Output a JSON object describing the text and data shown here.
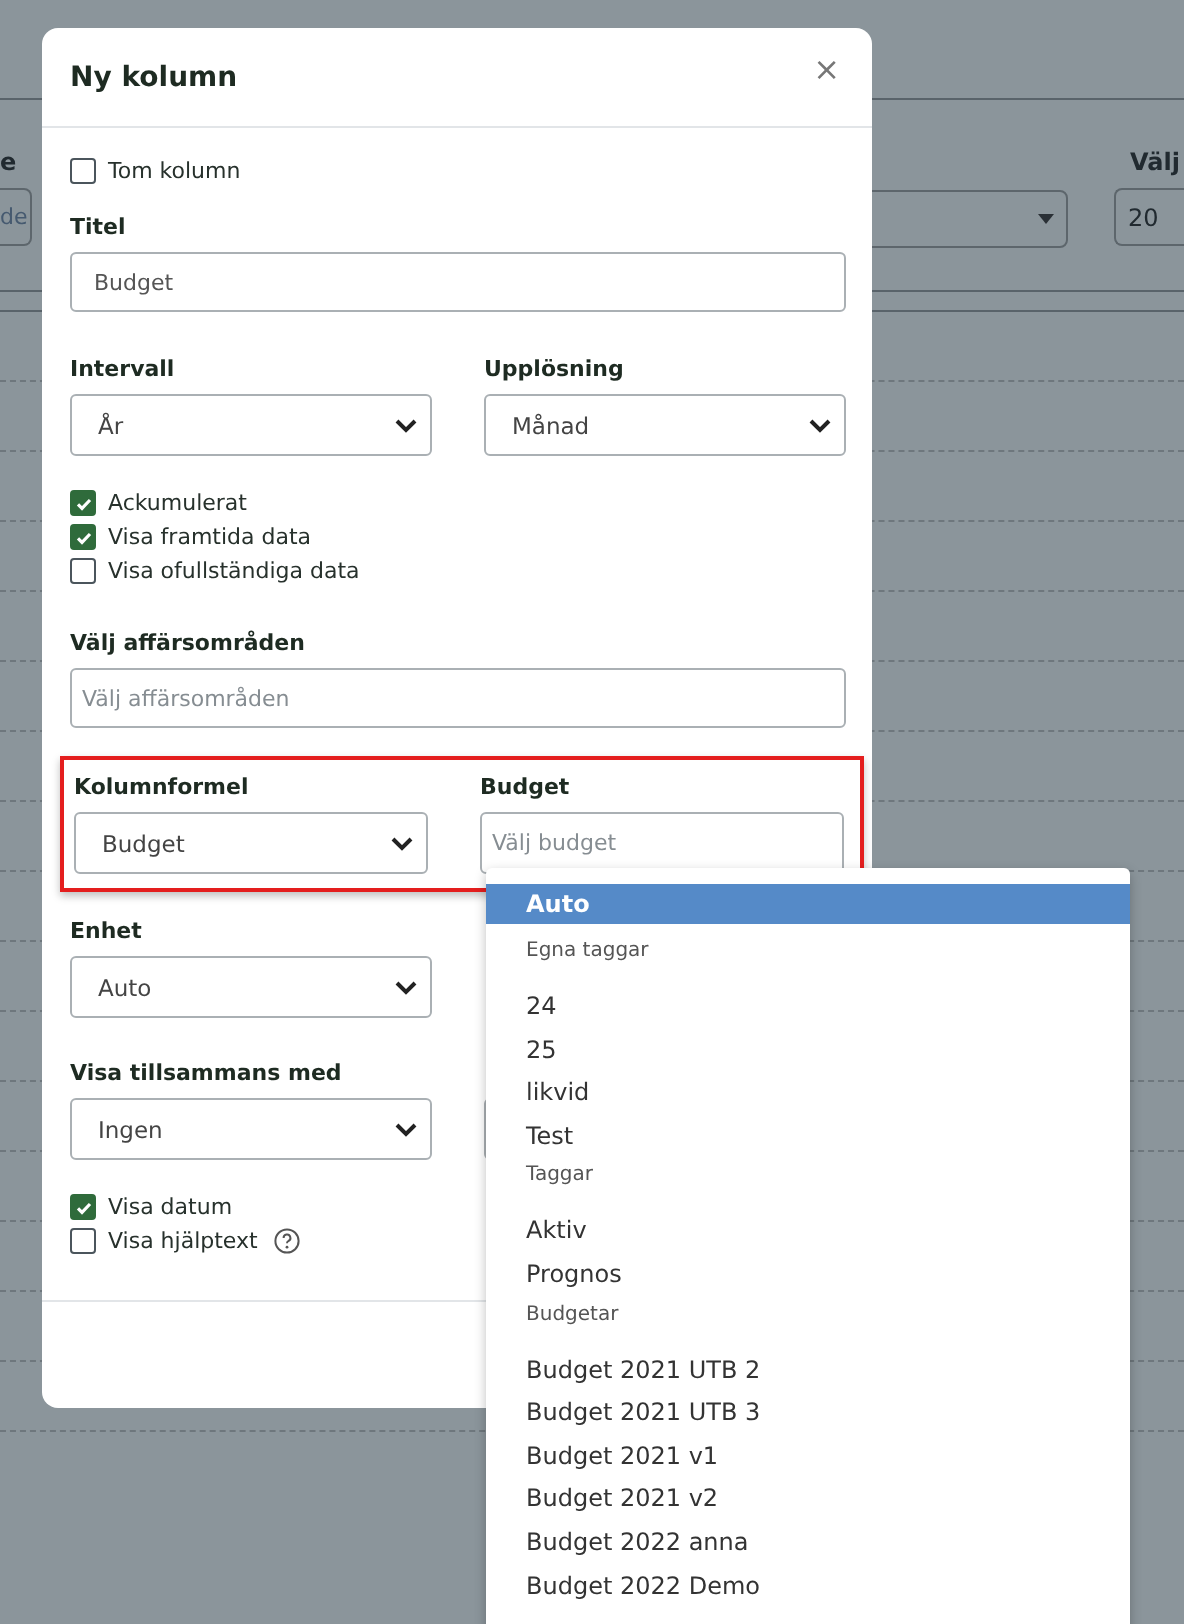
{
  "background": {
    "left_label": "e",
    "left_placeholder": "de",
    "right_label": "Välj",
    "right_value": "20"
  },
  "dialog": {
    "title": "Ny kolumn",
    "close": "×",
    "empty_column": {
      "label": "Tom kolumn",
      "checked": false
    },
    "title_field": {
      "label": "Titel",
      "value": "Budget"
    },
    "interval": {
      "label": "Intervall",
      "value": "År"
    },
    "resolution": {
      "label": "Upplösning",
      "value": "Månad"
    },
    "options": [
      {
        "label": "Ackumulerat",
        "checked": true
      },
      {
        "label": "Visa framtida data",
        "checked": true
      },
      {
        "label": "Visa ofullständiga data",
        "checked": false
      }
    ],
    "business_areas": {
      "label": "Välj affärsområden",
      "placeholder": "Välj affärsområden"
    },
    "formula": {
      "label": "Kolumnformel",
      "value": "Budget"
    },
    "budget": {
      "label": "Budget",
      "placeholder": "Välj budget"
    },
    "unit": {
      "label": "Enhet",
      "value": "Auto"
    },
    "show_with": {
      "label": "Visa tillsammans med",
      "value": "Ingen"
    },
    "display_options": [
      {
        "label": "Visa datum",
        "checked": true,
        "help": false
      },
      {
        "label": "Visa hjälptext",
        "checked": false,
        "help": true
      }
    ]
  },
  "dropdown": {
    "items": [
      {
        "kind": "option",
        "label": "Auto",
        "selected": true
      },
      {
        "kind": "group",
        "label": "Egna taggar"
      },
      {
        "kind": "option",
        "label": "24",
        "selected": false
      },
      {
        "kind": "option",
        "label": "25",
        "selected": false
      },
      {
        "kind": "option",
        "label": "likvid",
        "selected": false
      },
      {
        "kind": "option",
        "label": "Test",
        "selected": false
      },
      {
        "kind": "group",
        "label": "Taggar"
      },
      {
        "kind": "option",
        "label": "Aktiv",
        "selected": false
      },
      {
        "kind": "option",
        "label": "Prognos",
        "selected": false
      },
      {
        "kind": "group",
        "label": "Budgetar"
      },
      {
        "kind": "option",
        "label": "Budget 2021 UTB 2",
        "selected": false
      },
      {
        "kind": "option",
        "label": "Budget 2021 UTB 3",
        "selected": false
      },
      {
        "kind": "option",
        "label": "Budget 2021 v1",
        "selected": false
      },
      {
        "kind": "option",
        "label": "Budget 2021 v2",
        "selected": false
      },
      {
        "kind": "option",
        "label": "Budget 2022 anna",
        "selected": false
      },
      {
        "kind": "option",
        "label": "Budget 2022 Demo",
        "selected": false
      }
    ]
  }
}
